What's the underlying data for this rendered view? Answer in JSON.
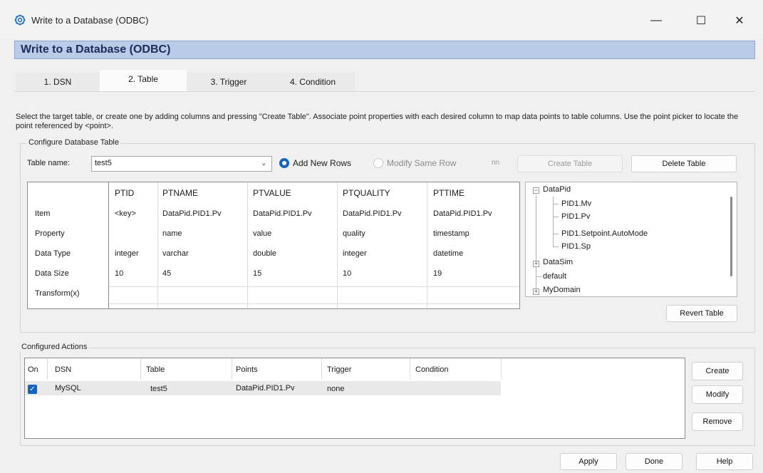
{
  "window": {
    "title": "Write to a Database (ODBC)",
    "minimize_glyph": "—",
    "maximize_glyph": "☐",
    "close_glyph": "✕",
    "icon": "gear-icon"
  },
  "banner": {
    "title": "Write to a Database (ODBC)"
  },
  "tabs": [
    {
      "label": "1. DSN"
    },
    {
      "label": "2. Table"
    },
    {
      "label": "3. Trigger"
    },
    {
      "label": "4. Condition"
    }
  ],
  "instructions": "Select the target table, or create one by adding columns and pressing \"Create Table\".  Associate point properties with each desired column to map data points to table columns.  Use the point picker to locate the point referenced by <point>.",
  "configure": {
    "group_title": "Configure Database Table",
    "table_name_label": "Table name:",
    "table_name_value": "test5",
    "add_new_rows_label": "Add New Rows",
    "modify_same_row_label": "Modify Same Row",
    "modify_same_row_value": "nn",
    "create_table_label": "Create Table",
    "delete_table_label": "Delete Table",
    "revert_table_label": "Revert Table"
  },
  "grid": {
    "row_headers": [
      "Item",
      "Property",
      "Data Type",
      "Data Size",
      "Transform(x)"
    ],
    "columns": [
      {
        "name": "PTID",
        "item": "<key>",
        "property": "",
        "data_type": "integer",
        "data_size": "10",
        "transform": ""
      },
      {
        "name": "PTNAME",
        "item": "DataPid.PID1.Pv",
        "property": "name",
        "data_type": "varchar",
        "data_size": "45",
        "transform": ""
      },
      {
        "name": "PTVALUE",
        "item": "DataPid.PID1.Pv",
        "property": "value",
        "data_type": "double",
        "data_size": "15",
        "transform": ""
      },
      {
        "name": "PTQUALITY",
        "item": "DataPid.PID1.Pv",
        "property": "quality",
        "data_type": "integer",
        "data_size": "10",
        "transform": ""
      },
      {
        "name": "PTTIME",
        "item": "DataPid.PID1.Pv",
        "property": "timestamp",
        "data_type": "datetime",
        "data_size": "19",
        "transform": ""
      }
    ]
  },
  "tree": {
    "nodes": [
      {
        "label": "DataPid",
        "expander": "⊟"
      },
      {
        "label": "PID1.Mv"
      },
      {
        "label": "PID1.Pv"
      },
      {
        "label": "PID1.Setpoint.AutoMode"
      },
      {
        "label": "PID1.Sp"
      },
      {
        "label": "DataSim",
        "expander": "⊞"
      },
      {
        "label": "default"
      },
      {
        "label": "MyDomain",
        "expander": "⊞"
      }
    ]
  },
  "actions": {
    "group_title": "Configured Actions",
    "headers": [
      "On",
      "DSN",
      "Table",
      "Points",
      "Trigger",
      "Condition"
    ],
    "rows": [
      {
        "on": "✓",
        "dsn": "MySQL",
        "table": "test5",
        "points": "DataPid.PID1.Pv",
        "trigger": "none",
        "condition": ""
      }
    ],
    "create_label": "Create",
    "modify_label": "Modify",
    "remove_label": "Remove"
  },
  "footer": {
    "apply_label": "Apply",
    "done_label": "Done",
    "help_label": "Help"
  }
}
